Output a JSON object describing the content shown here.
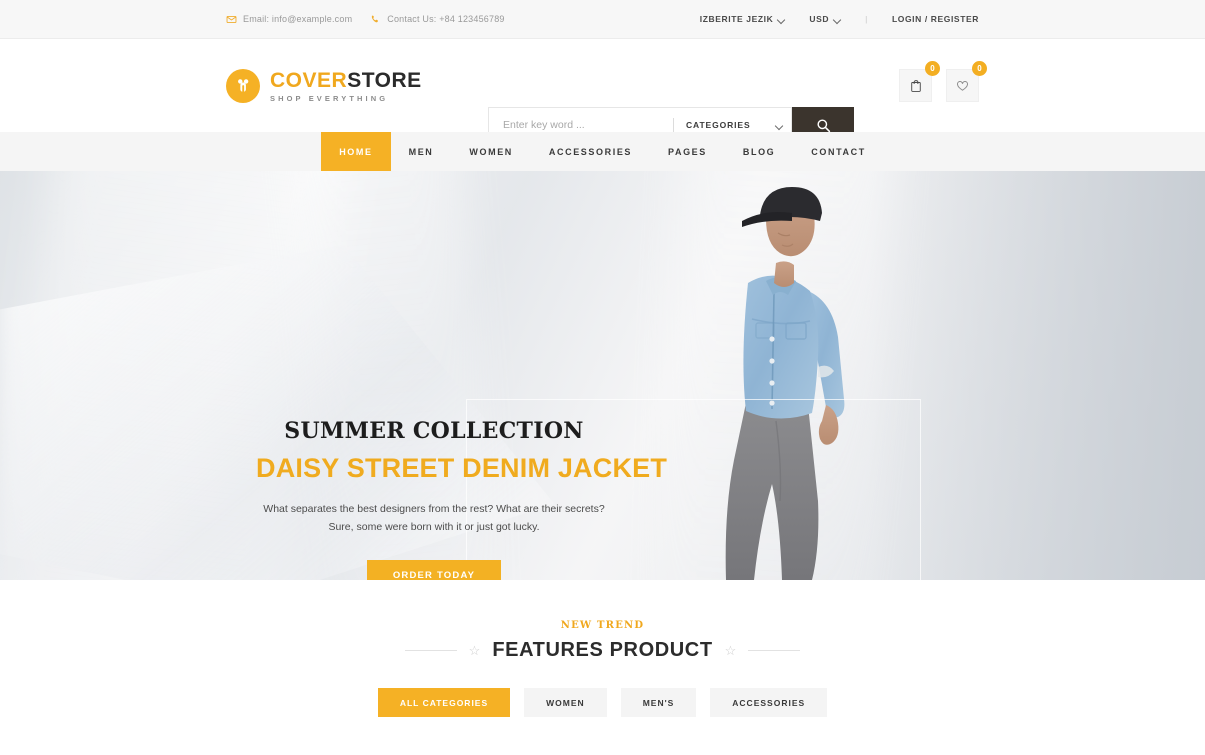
{
  "topbar": {
    "email_icon": "envelope-icon",
    "email": "Email: info@example.com",
    "phone_icon": "phone-icon",
    "phone": "Contact Us: +84 123456789",
    "language": "IZBERITE JEZIK",
    "currency": "USD",
    "account": "LOGIN / REGISTER"
  },
  "header": {
    "logo": {
      "icon": "cover-store-logo-icon",
      "name_primary": "COVER",
      "name_secondary": "STORE",
      "tagline": "SHOP EVERYTHING"
    },
    "search": {
      "placeholder": "Enter key word ...",
      "value": "",
      "category_label": "CATEGORIES",
      "button_icon": "search-icon"
    },
    "cart": {
      "icon": "shopping-bag-icon",
      "count": "0"
    },
    "wishlist": {
      "icon": "heart-icon",
      "count": "0"
    }
  },
  "nav": {
    "items": [
      {
        "label": "HOME",
        "active": true
      },
      {
        "label": "MEN",
        "active": false
      },
      {
        "label": "WOMEN",
        "active": false
      },
      {
        "label": "ACCESSORIES",
        "active": false
      },
      {
        "label": "PAGES",
        "active": false
      },
      {
        "label": "BLOG",
        "active": false
      },
      {
        "label": "CONTACT",
        "active": false
      }
    ]
  },
  "hero": {
    "eyebrow": "SUMMER COLLECTION",
    "title": "DAISY STREET DENIM JACKET",
    "description": "What separates the best designers from the rest? What are their secrets? Sure, some were born with it or just got lucky.",
    "cta_label": "ORDER TODAY",
    "image_alt": "model-in-denim-jacket"
  },
  "features": {
    "eyebrow": "NEW TREND",
    "title": "FEATURES PRODUCT",
    "star_icon": "star-icon",
    "filters": [
      {
        "label": "ALL CATEGORIES",
        "active": true
      },
      {
        "label": "WOMEN",
        "active": false
      },
      {
        "label": "MEN'S",
        "active": false
      },
      {
        "label": "ACCESSORIES",
        "active": false
      }
    ]
  },
  "colors": {
    "accent": "#f5b125",
    "accent_text": "#f0a81e",
    "dark": "#3b342d",
    "topbar_bg": "#f7f7f7",
    "nav_bg": "#f5f5f5"
  }
}
